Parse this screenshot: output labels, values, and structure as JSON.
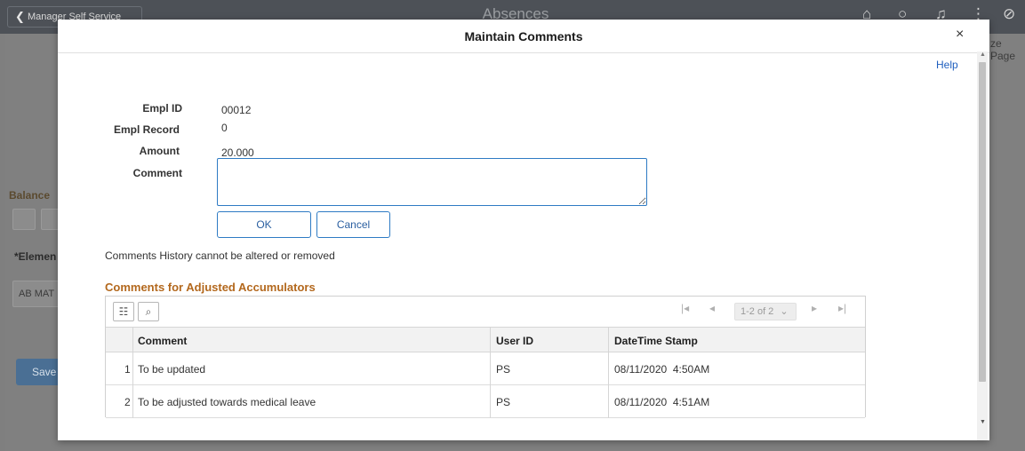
{
  "background": {
    "back_label": "Manager Self Service",
    "page_title": "Absences",
    "balance_label": "Balance",
    "element_label": "*Elemen",
    "element_value": "AB MAT",
    "save_label": "Save",
    "right_text": "ze Page"
  },
  "modal": {
    "title": "Maintain Comments",
    "close_glyph": "×",
    "help_label": "Help",
    "fields": {
      "empl_id_label": "Empl ID",
      "empl_id_value": "00012",
      "empl_record_label": "Empl Record",
      "empl_record_value": "0",
      "amount_label": "Amount",
      "amount_value": "20.000",
      "comment_label": "Comment",
      "comment_value": ""
    },
    "ok_label": "OK",
    "cancel_label": "Cancel",
    "note": "Comments History cannot be altered or removed",
    "section_title": "Comments for Adjusted Accumulators"
  },
  "grid": {
    "pager_text": "1-2 of 2",
    "columns": [
      "Comment",
      "User ID",
      "DateTime Stamp"
    ],
    "rows": [
      {
        "num": "1",
        "comment": "To be updated",
        "user_id": "PS",
        "stamp": "08/11/2020  4:50AM"
      },
      {
        "num": "2",
        "comment": "To be adjusted towards medical leave",
        "user_id": "PS",
        "stamp": "08/11/2020  4:51AM"
      }
    ]
  },
  "colors": {
    "accent": "#2e7bc4",
    "section_title": "#b3681d",
    "link": "#1f5fbf"
  },
  "icons": [
    "back-chevron-icon",
    "home-icon",
    "search-icon",
    "notification-icon",
    "actions-menu-icon",
    "navbar-icon",
    "close-icon",
    "grid-personalize-icon",
    "grid-search-icon",
    "first-page-icon",
    "previous-page-icon",
    "next-page-icon",
    "last-page-icon",
    "dropdown-chevron-icon"
  ]
}
